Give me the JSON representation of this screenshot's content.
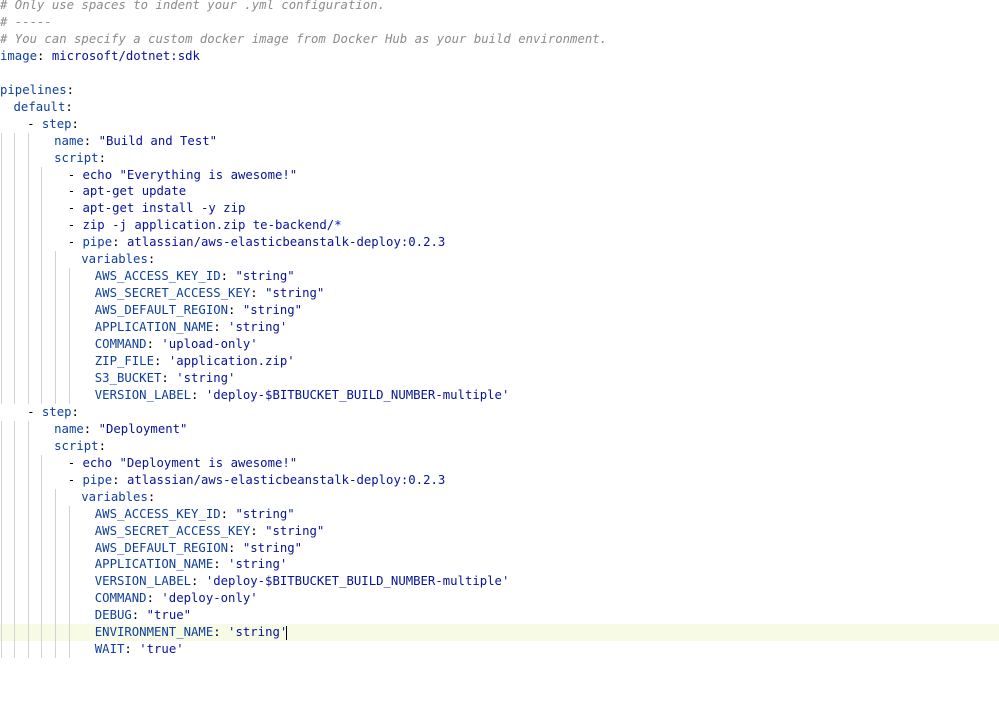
{
  "editor": {
    "lines": [
      {
        "indent": 0,
        "guides": 0,
        "parts": [
          {
            "t": "comment",
            "v": "# Only use spaces to indent your .yml configuration."
          }
        ]
      },
      {
        "indent": 0,
        "guides": 0,
        "parts": [
          {
            "t": "comment",
            "v": "# -----"
          }
        ]
      },
      {
        "indent": 0,
        "guides": 0,
        "parts": [
          {
            "t": "comment",
            "v": "# You can specify a custom docker image from Docker Hub as your build environment."
          }
        ]
      },
      {
        "indent": 0,
        "guides": 0,
        "parts": [
          {
            "t": "key",
            "v": "image"
          },
          {
            "t": "punct",
            "v": ": "
          },
          {
            "t": "val",
            "v": "microsoft/dotnet:sdk"
          }
        ]
      },
      {
        "indent": 0,
        "guides": 0,
        "parts": []
      },
      {
        "indent": 0,
        "guides": 0,
        "parts": [
          {
            "t": "key",
            "v": "pipelines"
          },
          {
            "t": "punct",
            "v": ":"
          }
        ]
      },
      {
        "indent": 2,
        "guides": 0,
        "parts": [
          {
            "t": "key",
            "v": "default"
          },
          {
            "t": "punct",
            "v": ":"
          }
        ]
      },
      {
        "indent": 4,
        "guides": 0,
        "parts": [
          {
            "t": "dash",
            "v": "- "
          },
          {
            "t": "key",
            "v": "step"
          },
          {
            "t": "punct",
            "v": ":"
          }
        ]
      },
      {
        "indent": 8,
        "guides": 3,
        "parts": [
          {
            "t": "key",
            "v": "name"
          },
          {
            "t": "punct",
            "v": ": "
          },
          {
            "t": "str",
            "v": "\"Build and Test\""
          }
        ]
      },
      {
        "indent": 8,
        "guides": 3,
        "parts": [
          {
            "t": "key",
            "v": "script"
          },
          {
            "t": "punct",
            "v": ":"
          }
        ]
      },
      {
        "indent": 10,
        "guides": 4,
        "parts": [
          {
            "t": "dash",
            "v": "- "
          },
          {
            "t": "val",
            "v": "echo \"Everything is awesome!\""
          }
        ]
      },
      {
        "indent": 10,
        "guides": 4,
        "parts": [
          {
            "t": "dash",
            "v": "- "
          },
          {
            "t": "val",
            "v": "apt-get update"
          }
        ]
      },
      {
        "indent": 10,
        "guides": 4,
        "parts": [
          {
            "t": "dash",
            "v": "- "
          },
          {
            "t": "val",
            "v": "apt-get install -y zip"
          }
        ]
      },
      {
        "indent": 10,
        "guides": 4,
        "parts": [
          {
            "t": "dash",
            "v": "- "
          },
          {
            "t": "val",
            "v": "zip -j application.zip te-backend/*"
          }
        ]
      },
      {
        "indent": 10,
        "guides": 4,
        "parts": [
          {
            "t": "dash",
            "v": "- "
          },
          {
            "t": "key",
            "v": "pipe"
          },
          {
            "t": "punct",
            "v": ": "
          },
          {
            "t": "val",
            "v": "atlassian/aws-elasticbeanstalk-deploy:0.2.3"
          }
        ]
      },
      {
        "indent": 12,
        "guides": 5,
        "parts": [
          {
            "t": "key",
            "v": "variables"
          },
          {
            "t": "punct",
            "v": ":"
          }
        ]
      },
      {
        "indent": 14,
        "guides": 6,
        "parts": [
          {
            "t": "key",
            "v": "AWS_ACCESS_KEY_ID"
          },
          {
            "t": "punct",
            "v": ": "
          },
          {
            "t": "str",
            "v": "\"string\""
          }
        ]
      },
      {
        "indent": 14,
        "guides": 6,
        "parts": [
          {
            "t": "key",
            "v": "AWS_SECRET_ACCESS_KEY"
          },
          {
            "t": "punct",
            "v": ": "
          },
          {
            "t": "str",
            "v": "\"string\""
          }
        ]
      },
      {
        "indent": 14,
        "guides": 6,
        "parts": [
          {
            "t": "key",
            "v": "AWS_DEFAULT_REGION"
          },
          {
            "t": "punct",
            "v": ": "
          },
          {
            "t": "str",
            "v": "\"string\""
          }
        ]
      },
      {
        "indent": 14,
        "guides": 6,
        "parts": [
          {
            "t": "key",
            "v": "APPLICATION_NAME"
          },
          {
            "t": "punct",
            "v": ": "
          },
          {
            "t": "str",
            "v": "'string'"
          }
        ]
      },
      {
        "indent": 14,
        "guides": 6,
        "parts": [
          {
            "t": "key",
            "v": "COMMAND"
          },
          {
            "t": "punct",
            "v": ": "
          },
          {
            "t": "str",
            "v": "'upload-only'"
          }
        ]
      },
      {
        "indent": 14,
        "guides": 6,
        "parts": [
          {
            "t": "key",
            "v": "ZIP_FILE"
          },
          {
            "t": "punct",
            "v": ": "
          },
          {
            "t": "str",
            "v": "'application.zip'"
          }
        ]
      },
      {
        "indent": 14,
        "guides": 6,
        "parts": [
          {
            "t": "key",
            "v": "S3_BUCKET"
          },
          {
            "t": "punct",
            "v": ": "
          },
          {
            "t": "str",
            "v": "'string'"
          }
        ]
      },
      {
        "indent": 14,
        "guides": 6,
        "parts": [
          {
            "t": "key",
            "v": "VERSION_LABEL"
          },
          {
            "t": "punct",
            "v": ": "
          },
          {
            "t": "str",
            "v": "'deploy-$BITBUCKET_BUILD_NUMBER-multiple'"
          }
        ]
      },
      {
        "indent": 4,
        "guides": 0,
        "parts": [
          {
            "t": "dash",
            "v": "- "
          },
          {
            "t": "key",
            "v": "step"
          },
          {
            "t": "punct",
            "v": ":"
          }
        ]
      },
      {
        "indent": 8,
        "guides": 3,
        "parts": [
          {
            "t": "key",
            "v": "name"
          },
          {
            "t": "punct",
            "v": ": "
          },
          {
            "t": "str",
            "v": "\"Deployment\""
          }
        ]
      },
      {
        "indent": 8,
        "guides": 3,
        "parts": [
          {
            "t": "key",
            "v": "script"
          },
          {
            "t": "punct",
            "v": ":"
          }
        ]
      },
      {
        "indent": 10,
        "guides": 4,
        "parts": [
          {
            "t": "dash",
            "v": "- "
          },
          {
            "t": "val",
            "v": "echo \"Deployment is awesome!\""
          }
        ]
      },
      {
        "indent": 10,
        "guides": 4,
        "parts": [
          {
            "t": "dash",
            "v": "- "
          },
          {
            "t": "key",
            "v": "pipe"
          },
          {
            "t": "punct",
            "v": ": "
          },
          {
            "t": "val",
            "v": "atlassian/aws-elasticbeanstalk-deploy:0.2.3"
          }
        ]
      },
      {
        "indent": 12,
        "guides": 5,
        "parts": [
          {
            "t": "key",
            "v": "variables"
          },
          {
            "t": "punct",
            "v": ":"
          }
        ]
      },
      {
        "indent": 14,
        "guides": 6,
        "parts": [
          {
            "t": "key",
            "v": "AWS_ACCESS_KEY_ID"
          },
          {
            "t": "punct",
            "v": ": "
          },
          {
            "t": "str",
            "v": "\"string\""
          }
        ]
      },
      {
        "indent": 14,
        "guides": 6,
        "parts": [
          {
            "t": "key",
            "v": "AWS_SECRET_ACCESS_KEY"
          },
          {
            "t": "punct",
            "v": ": "
          },
          {
            "t": "str",
            "v": "\"string\""
          }
        ]
      },
      {
        "indent": 14,
        "guides": 6,
        "parts": [
          {
            "t": "key",
            "v": "AWS_DEFAULT_REGION"
          },
          {
            "t": "punct",
            "v": ": "
          },
          {
            "t": "str",
            "v": "\"string\""
          }
        ]
      },
      {
        "indent": 14,
        "guides": 6,
        "parts": [
          {
            "t": "key",
            "v": "APPLICATION_NAME"
          },
          {
            "t": "punct",
            "v": ": "
          },
          {
            "t": "str",
            "v": "'string'"
          }
        ]
      },
      {
        "indent": 14,
        "guides": 6,
        "parts": [
          {
            "t": "key",
            "v": "VERSION_LABEL"
          },
          {
            "t": "punct",
            "v": ": "
          },
          {
            "t": "str",
            "v": "'deploy-$BITBUCKET_BUILD_NUMBER-multiple'"
          }
        ]
      },
      {
        "indent": 14,
        "guides": 6,
        "parts": [
          {
            "t": "key",
            "v": "COMMAND"
          },
          {
            "t": "punct",
            "v": ": "
          },
          {
            "t": "str",
            "v": "'deploy-only'"
          }
        ]
      },
      {
        "indent": 14,
        "guides": 6,
        "parts": [
          {
            "t": "key",
            "v": "DEBUG"
          },
          {
            "t": "punct",
            "v": ": "
          },
          {
            "t": "str",
            "v": "\"true\""
          }
        ]
      },
      {
        "indent": 14,
        "guides": 6,
        "current": true,
        "caret": true,
        "parts": [
          {
            "t": "key",
            "v": "ENVIRONMENT_NAME"
          },
          {
            "t": "punct",
            "v": ": "
          },
          {
            "t": "str",
            "v": "'string'"
          }
        ]
      },
      {
        "indent": 14,
        "guides": 6,
        "parts": [
          {
            "t": "key",
            "v": "WAIT"
          },
          {
            "t": "punct",
            "v": ": "
          },
          {
            "t": "str",
            "v": "'true'"
          }
        ]
      }
    ]
  }
}
